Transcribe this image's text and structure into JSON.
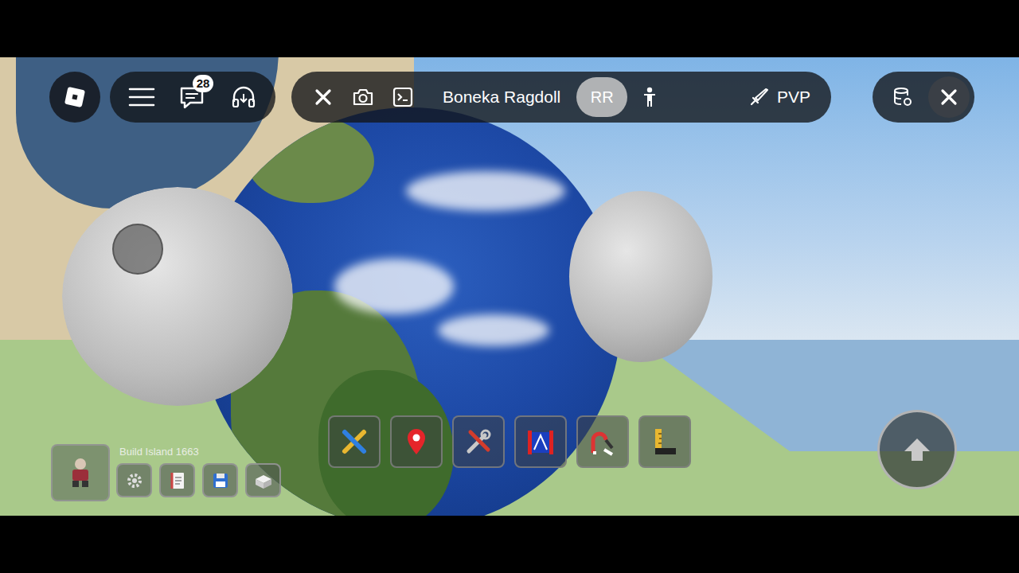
{
  "topbar": {
    "chat_badge": "28",
    "title": "Boneka Ragdoll",
    "toggles": [
      {
        "label": "RR",
        "kind": "circle",
        "selected": true
      },
      {
        "label": "PVP",
        "kind": "sword",
        "selected": false
      }
    ]
  },
  "build_panel": {
    "label": "Build Island 1663"
  }
}
